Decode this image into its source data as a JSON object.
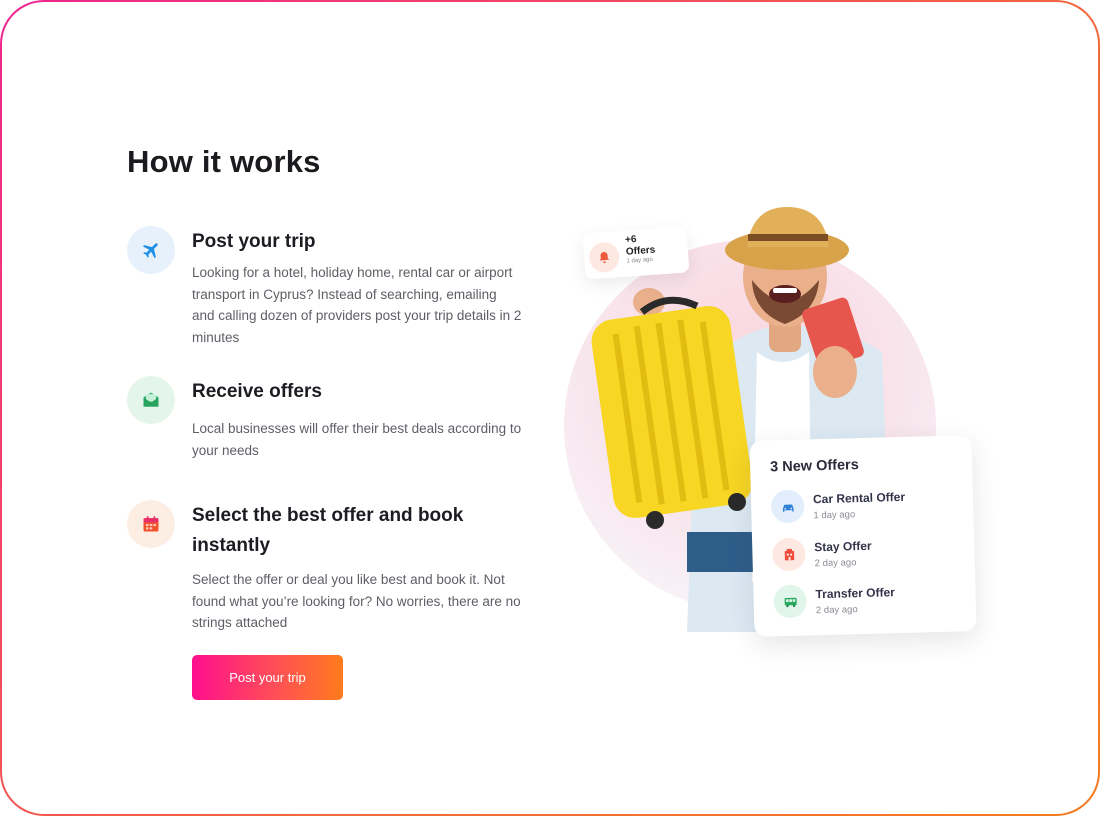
{
  "section": {
    "title": "How it works"
  },
  "steps": [
    {
      "icon": "airplane-icon",
      "title": "Post your trip",
      "description": "Looking for a hotel, holiday home, rental car or airport transport in Cyprus? Instead of searching, emailing and calling dozen of providers post your trip details in 2 minutes"
    },
    {
      "icon": "envelope-offer-icon",
      "title": "Receive offers",
      "description": "Local businesses will offer their best deals according to your needs"
    },
    {
      "icon": "calendar-icon",
      "title": "Select the best offer and book instantly",
      "description": "Select the offer or deal you like best and book it. Not found what you’re looking for? No worries, there are no strings attached"
    }
  ],
  "cta": {
    "label": "Post your trip"
  },
  "notification": {
    "count": "+6",
    "label": "Offers",
    "time": "1 day ago"
  },
  "offers_card": {
    "title": "3 New Offers",
    "items": [
      {
        "name": "Car Rental Offer",
        "time": "1 day ago",
        "icon": "car-icon"
      },
      {
        "name": "Stay Offer",
        "time": "2 day ago",
        "icon": "hotel-icon"
      },
      {
        "name": "Transfer Offer",
        "time": "2 day ago",
        "icon": "bus-icon"
      }
    ]
  },
  "colors": {
    "brand_gradient_start": "#ff0f8d",
    "brand_gradient_end": "#ff7c1c",
    "title_text": "#1b1b1f",
    "body_text": "#5e5e66"
  }
}
